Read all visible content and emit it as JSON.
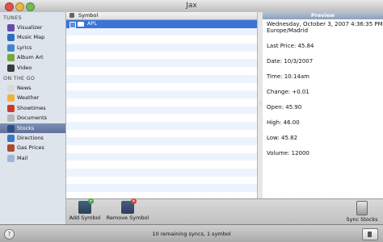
{
  "window": {
    "title": "Jax"
  },
  "sidebar": {
    "sections": [
      {
        "header": "TUNES",
        "items": [
          {
            "label": "Visualizer",
            "icon": "visualizer-icon",
            "color": "#6b4aa8"
          },
          {
            "label": "Music Map",
            "icon": "music-map-icon",
            "color": "#2f6cc2"
          },
          {
            "label": "Lyrics",
            "icon": "lyrics-icon",
            "color": "#3f86cf"
          },
          {
            "label": "Album Art",
            "icon": "album-art-icon",
            "color": "#7aa83a"
          },
          {
            "label": "Video",
            "icon": "video-icon",
            "color": "#3b3b3b"
          }
        ]
      },
      {
        "header": "ON THE GO",
        "items": [
          {
            "label": "News",
            "icon": "news-icon",
            "color": "#d9d9d9"
          },
          {
            "label": "Weather",
            "icon": "weather-icon",
            "color": "#f0b23a"
          },
          {
            "label": "Showtimes",
            "icon": "showtimes-icon",
            "color": "#c9392b"
          },
          {
            "label": "Documents",
            "icon": "documents-icon",
            "color": "#b7b7b7"
          },
          {
            "label": "Stocks",
            "icon": "stocks-icon",
            "color": "#2d4f80",
            "selected": true
          },
          {
            "label": "Directions",
            "icon": "directions-icon",
            "color": "#3a78c9"
          },
          {
            "label": "Gas Prices",
            "icon": "gas-prices-icon",
            "color": "#b3462f"
          },
          {
            "label": "Mail",
            "icon": "mail-icon",
            "color": "#9fb6d4"
          }
        ]
      }
    ]
  },
  "list": {
    "column_header": "Symbol",
    "rows": [
      {
        "symbol": "APL",
        "checked": true,
        "selected": true
      }
    ]
  },
  "preview": {
    "header": "Preview",
    "date_line": "Wednesday, October 3, 2007 4:36:35 PM",
    "timezone": "Europe/Madrid",
    "last_price": "Last Price: 45.84",
    "date": "Date: 10/3/2007",
    "time": "Time: 10:14am",
    "change": "Change: +0.01",
    "open": "Open: 45.90",
    "high": "High: 46.00",
    "low": "Low: 45.82",
    "volume": "Volume: 12000"
  },
  "toolbar": {
    "add_label": "Add Symbol",
    "remove_label": "Remove Symbol",
    "sync_label": "Sync Stocks"
  },
  "status": {
    "text": "10 remaining syncs, 1 symbol"
  },
  "colors": {
    "selection": "#3875d7",
    "sidebar_bg": "#dde4ec",
    "stripe": "#edf3fe"
  }
}
